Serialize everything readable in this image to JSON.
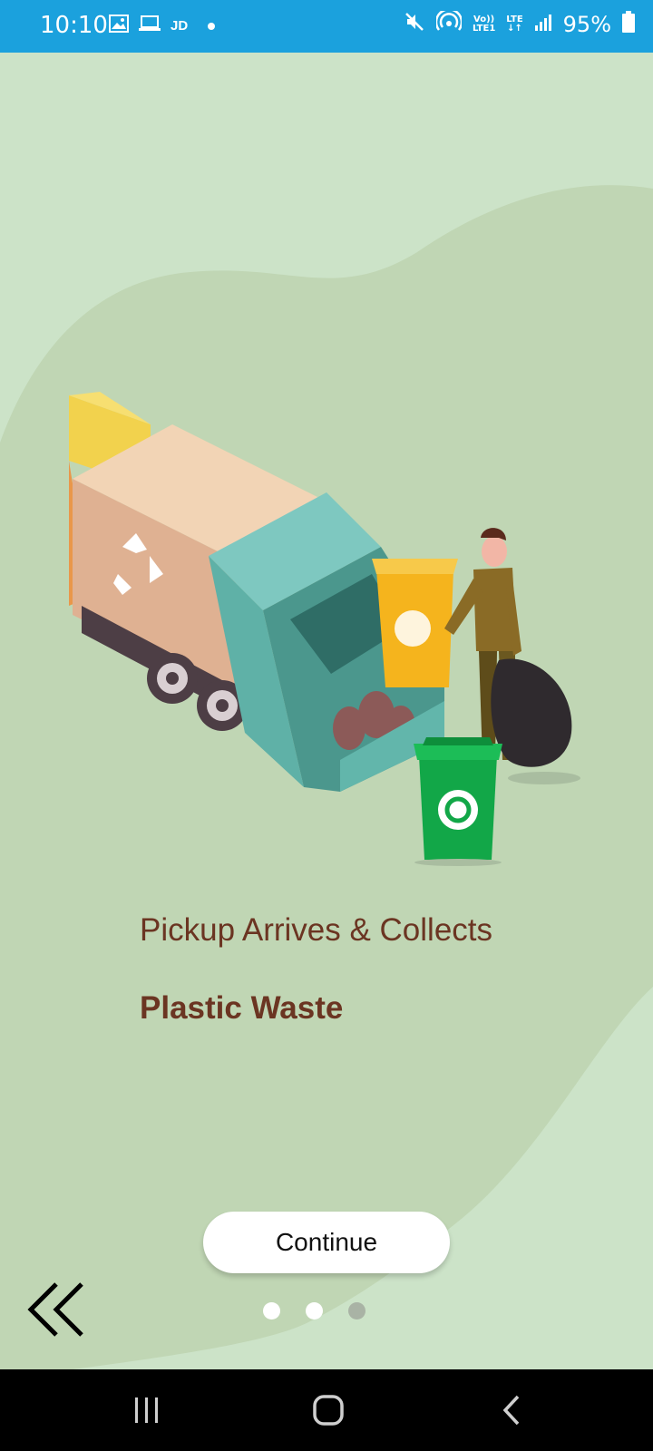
{
  "status_bar": {
    "time": "10:10",
    "carrier_badge": "JD",
    "network_top": "Vo))",
    "network_bottom": "LTE1",
    "lte_top": "LTE",
    "battery": "95%"
  },
  "onboarding": {
    "title_line1": "Pickup Arrives & Collects",
    "title_line2": "Plastic Waste",
    "continue_label": "Continue",
    "back_icon": "double-chevron-left-icon",
    "pager": {
      "total": 3,
      "active_index": 2
    }
  },
  "nav_bar": {
    "recents_icon": "recents-icon",
    "home_icon": "home-icon",
    "back_icon": "back-icon"
  },
  "colors": {
    "status_bar": "#1ba1dd",
    "background": "#cce3c8",
    "blob": "#c0d6b4",
    "title": "#6b3522",
    "dot_inactive": "#ffffff",
    "dot_active": "#a9b3a5"
  }
}
